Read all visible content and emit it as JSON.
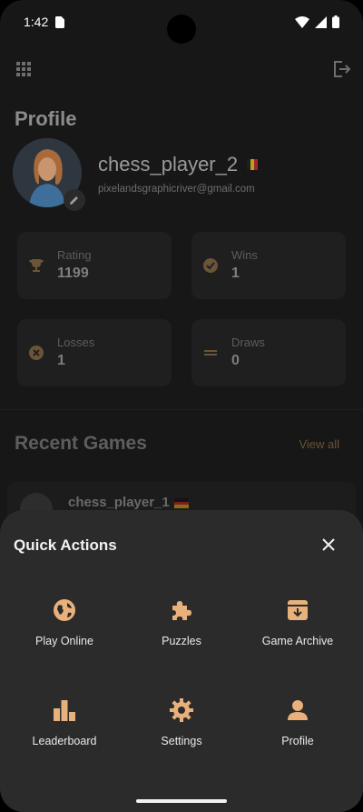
{
  "status_bar": {
    "time": "1:42"
  },
  "profile": {
    "title": "Profile",
    "username": "chess_player_2",
    "email": "pixelandsgraphicriver@gmail.com",
    "stats": [
      {
        "label": "Rating",
        "value": "1199",
        "icon": "trophy-icon"
      },
      {
        "label": "Wins",
        "value": "1",
        "icon": "check-circle-icon"
      },
      {
        "label": "Losses",
        "value": "1",
        "icon": "cancel-circle-icon"
      },
      {
        "label": "Draws",
        "value": "0",
        "icon": "equals-icon"
      }
    ]
  },
  "recent_games": {
    "title": "Recent Games",
    "view_all": "View all",
    "games": [
      {
        "player": "chess_player_1"
      }
    ]
  },
  "quick_actions": {
    "title": "Quick Actions",
    "items": [
      {
        "label": "Play Online",
        "icon": "globe-icon"
      },
      {
        "label": "Puzzles",
        "icon": "puzzle-icon"
      },
      {
        "label": "Game Archive",
        "icon": "archive-icon"
      },
      {
        "label": "Leaderboard",
        "icon": "leaderboard-icon"
      },
      {
        "label": "Settings",
        "icon": "gear-icon"
      },
      {
        "label": "Profile",
        "icon": "person-icon"
      }
    ]
  },
  "colors": {
    "accent": "#e8b07a",
    "sheet_bg": "#2b2b2b",
    "background": "#171717"
  }
}
